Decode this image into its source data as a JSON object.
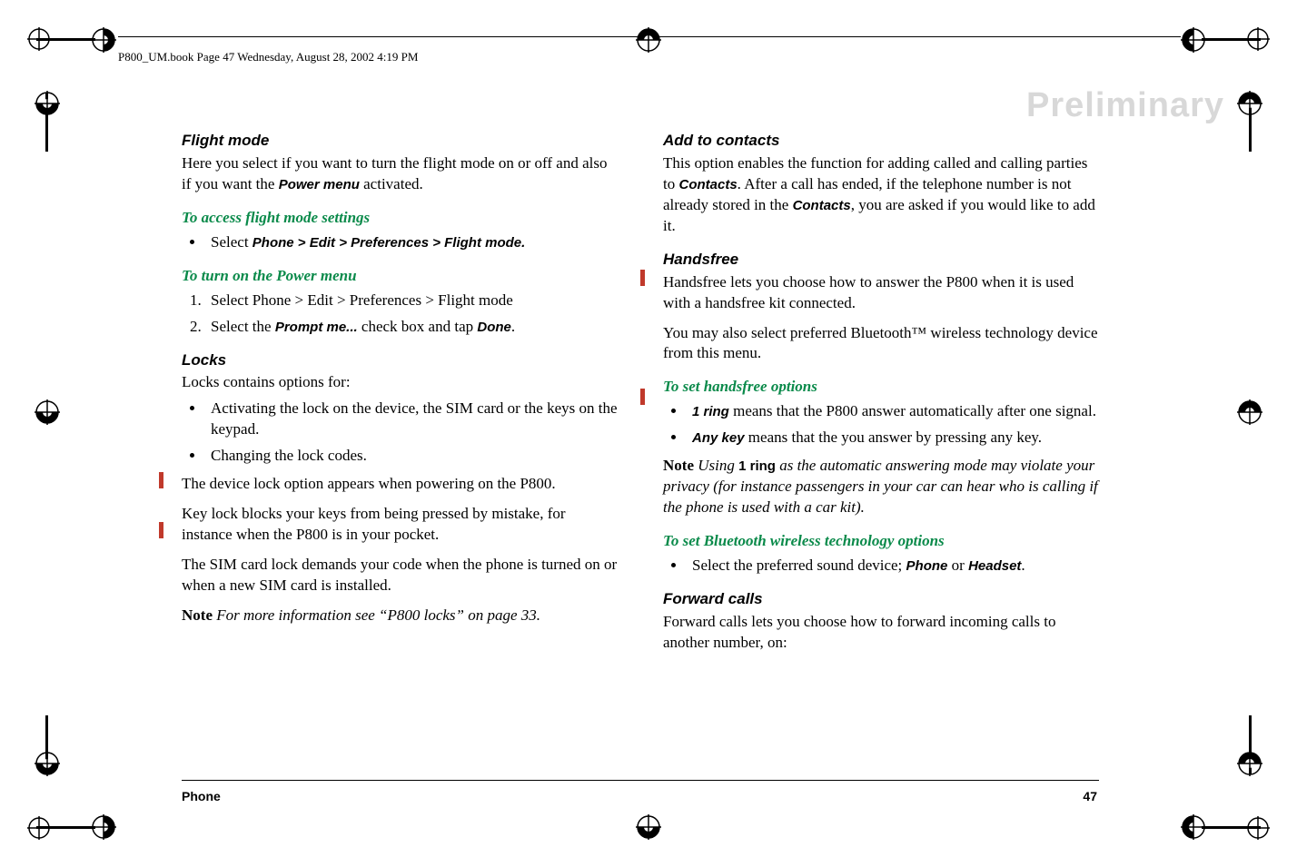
{
  "header": {
    "filepath": "P800_UM.book  Page 47  Wednesday, August 28, 2002  4:19 PM"
  },
  "watermark": "Preliminary",
  "left": {
    "h1": "Flight mode",
    "p1a": "Here you select if you want to turn the flight mode on or off and also if you want the ",
    "p1b": "Power menu",
    "p1c": " activated.",
    "sh1": "To access flight mode settings",
    "li1a": "Select ",
    "li1b": "Phone > Edit > Preferences > Flight mode.",
    "sh2": "To turn on the Power menu",
    "ol1": "Select Phone > Edit > Preferences > Flight mode",
    "ol2a": "Select the ",
    "ol2b": "Prompt me...",
    "ol2c": " check box and tap ",
    "ol2d": "Done",
    "ol2e": ".",
    "h2": "Locks",
    "p2": "Locks contains options for:",
    "li2": "Activating the lock on the device, the SIM card or the keys on the keypad.",
    "li3": "Changing the lock codes.",
    "p3": "The device lock option appears when powering on the P800.",
    "p4": "Key lock blocks your keys from being pressed by mistake, for instance when the P800 is in your pocket.",
    "p5": "The SIM card lock demands your code when the phone is turned on or when a new SIM card is installed.",
    "note_lead": "Note",
    "note": " For more information see “P800 locks” on page 33."
  },
  "right": {
    "h1": "Add to contacts",
    "p1a": "This option enables the function for adding called and calling parties to ",
    "p1b": "Contacts",
    "p1c": ". After a call has ended, if the telephone number is not already stored in the ",
    "p1d": "Contacts",
    "p1e": ", you are asked if you would like to add it.",
    "h2": "Handsfree",
    "p2": "Handsfree lets you choose how to answer the P800 when it is used with a handsfree kit connected.",
    "p3": "You may also select preferred Bluetooth™ wireless technology device from this menu.",
    "sh1": "To set handsfree options",
    "li1a": "1 ring",
    "li1b": " means that the P800 answer automatically after one signal.",
    "li2a": " Any key",
    "li2b": " means that the you answer by pressing any key.",
    "note_lead": "Note",
    "note_a": "  Using ",
    "note_b": "1 ring",
    "note_c": " as the automatic answering mode may violate your privacy (for instance passengers in your car can hear who is calling if the phone is used with a car kit).",
    "sh2": "To set Bluetooth wireless technology options",
    "li3a": "Select the preferred sound device; ",
    "li3b": "Phone",
    "li3c": " or ",
    "li3d": "Headset",
    "li3e": ".",
    "h3": "Forward calls",
    "p4": "Forward calls lets you choose how to forward incoming calls to another number, on:"
  },
  "footer": {
    "section": "Phone",
    "page": "47"
  }
}
